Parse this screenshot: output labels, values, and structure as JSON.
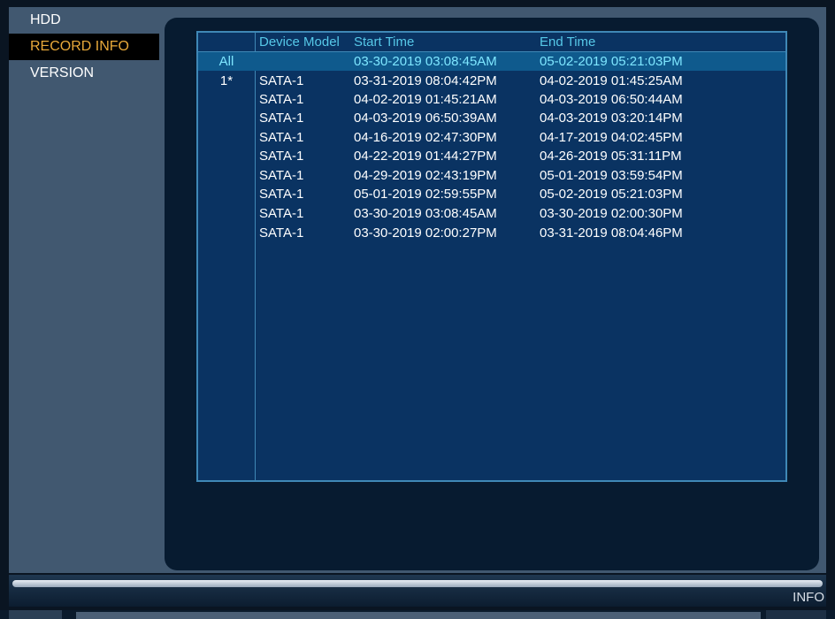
{
  "sidebar": {
    "items": [
      {
        "label": "HDD",
        "active": false
      },
      {
        "label": "RECORD INFO",
        "active": true
      },
      {
        "label": "VERSION",
        "active": false
      }
    ]
  },
  "table": {
    "headers": [
      "",
      "Device Model",
      "Start Time",
      "End Time"
    ],
    "all_row": {
      "index": "All",
      "model": "",
      "start": "03-30-2019 03:08:45AM",
      "end": "05-02-2019 05:21:03PM"
    },
    "rows": [
      {
        "index": "1*",
        "model": "SATA-1",
        "start": "03-31-2019 08:04:42PM",
        "end": "04-02-2019 01:45:25AM"
      },
      {
        "index": "",
        "model": "SATA-1",
        "start": "04-02-2019 01:45:21AM",
        "end": "04-03-2019 06:50:44AM"
      },
      {
        "index": "",
        "model": "SATA-1",
        "start": "04-03-2019 06:50:39AM",
        "end": "04-03-2019 03:20:14PM"
      },
      {
        "index": "",
        "model": "SATA-1",
        "start": "04-16-2019 02:47:30PM",
        "end": "04-17-2019 04:02:45PM"
      },
      {
        "index": "",
        "model": "SATA-1",
        "start": "04-22-2019 01:44:27PM",
        "end": "04-26-2019 05:31:11PM"
      },
      {
        "index": "",
        "model": "SATA-1",
        "start": "04-29-2019 02:43:19PM",
        "end": "05-01-2019 03:59:54PM"
      },
      {
        "index": "",
        "model": "SATA-1",
        "start": "05-01-2019 02:59:55PM",
        "end": "05-02-2019 05:21:03PM"
      },
      {
        "index": "",
        "model": "SATA-1",
        "start": "03-30-2019 03:08:45AM",
        "end": "03-30-2019 02:00:30PM"
      },
      {
        "index": "",
        "model": "SATA-1",
        "start": "03-30-2019 02:00:27PM",
        "end": "03-31-2019 08:04:46PM"
      }
    ]
  },
  "footer": {
    "info_label": "INFO"
  },
  "colors": {
    "active_label": "#e8a93a",
    "header_text": "#56c8e8",
    "selected_row_text": "#7ee6ff",
    "table_bg": "#0a3362",
    "panel_bg": "#415870"
  }
}
